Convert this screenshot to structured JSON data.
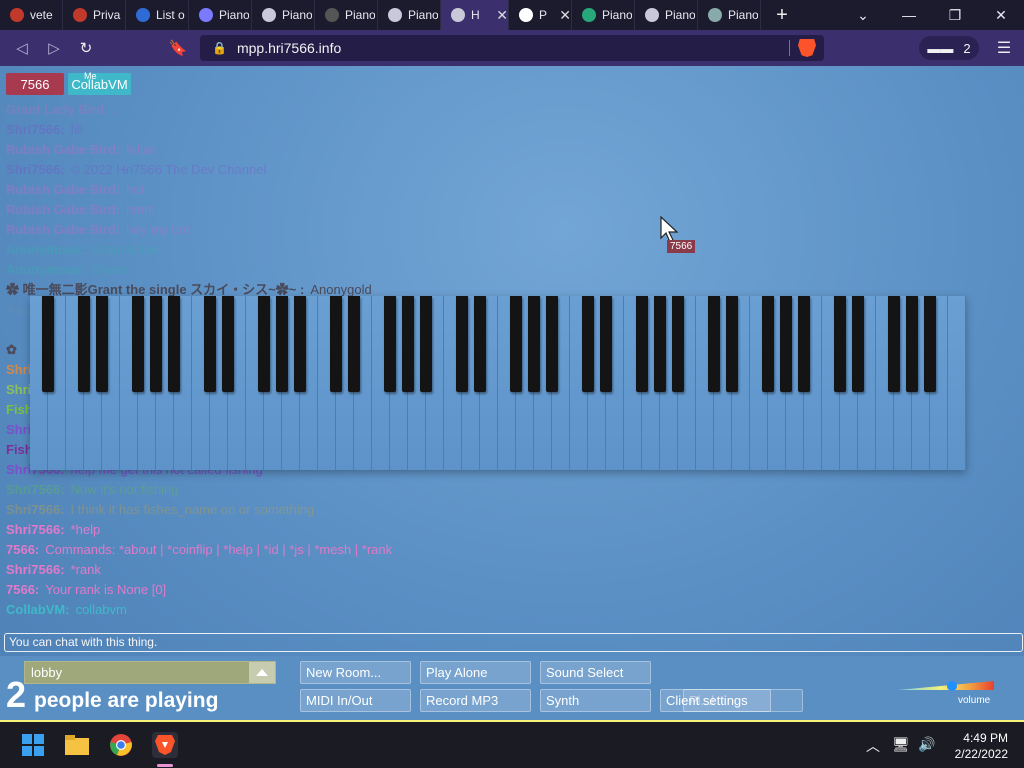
{
  "tabs": [
    {
      "label": "vete",
      "icon": "brave-shield-icon",
      "color": "#c0392b"
    },
    {
      "label": "Priva",
      "icon": "brave-shield-icon",
      "color": "#c0392b"
    },
    {
      "label": "List o",
      "icon": "bb-icon",
      "color": "#2f6bd6"
    },
    {
      "label": "Piano",
      "icon": "piano-swoosh-icon",
      "color": "#7a7aff"
    },
    {
      "label": "Piano",
      "icon": "globe-icon",
      "color": "#c8c8d8"
    },
    {
      "label": "Piano",
      "icon": "photo-icon",
      "color": "#555"
    },
    {
      "label": "Piano",
      "icon": "globe-icon",
      "color": "#c8c8d8"
    },
    {
      "label": "H",
      "icon": "globe-icon",
      "color": "#c8c8d8",
      "active": true
    },
    {
      "label": "P",
      "icon": "piano-keys-icon",
      "color": "#ffffff"
    },
    {
      "label": "Piano",
      "icon": "d-icon",
      "color": "#28a87a"
    },
    {
      "label": "Piano",
      "icon": "globe-icon",
      "color": "#c8c8d8"
    },
    {
      "label": "Piano",
      "icon": "bars-icon",
      "color": "#8aa"
    }
  ],
  "address": {
    "url": "mpp.hri7566.info",
    "private_windows": "2"
  },
  "users": [
    {
      "name": "7566",
      "color": "#a83a4f"
    },
    {
      "name": "CollabVM",
      "color": "#3fb9c9",
      "me_label": "Me"
    }
  ],
  "chat": [
    {
      "who": "Grant Lady Bird",
      "text": "...",
      "color": "#b86fc0",
      "faded": true
    },
    {
      "who": "Shri7566:",
      "text": "fill",
      "color": "#7a4fc9",
      "faded": true
    },
    {
      "who": "Rubish Gabe Bird:",
      "text": "fellas",
      "color": "#d066c9",
      "faded": true
    },
    {
      "who": "Shri7566:",
      "text": "© 2022 Hri7566 The Dev Channel",
      "color": "#7a4fc9",
      "faded": true
    },
    {
      "who": "Rubish Gabe Bird:",
      "text": "hot",
      "color": "#d066c9",
      "faded": true
    },
    {
      "who": "Rubish Gabe Bird:",
      "text": "hmm",
      "color": "#d066c9",
      "faded": true
    },
    {
      "who": "Rubish Gabe Bird:",
      "text": "hey my bot",
      "color": "#d066c9",
      "faded": true
    },
    {
      "who": "Anonymous:",
      "text": "Grant is fee",
      "color": "#2fb7a7",
      "faded": true
    },
    {
      "who": "Anonymous:",
      "text": "Share",
      "color": "#2fb7a7",
      "faded": true
    },
    {
      "who": "✿ 唯一無二影Grant the single スカイ・シス~✿~ :",
      "text": "Anonygold",
      "color": "#4a4a5a",
      "faded": false
    },
    {
      "who": "Anonymous:",
      "text": "",
      "color": "#6a8fb0",
      "faded": true
    },
    {
      "who": "",
      "text": "",
      "color": "#6a8fb0",
      "faded": true
    },
    {
      "who": "✿",
      "text": "",
      "color": "#4a4a5a",
      "faded": false
    },
    {
      "who": "Shri",
      "text": "",
      "color": "#d08a4a",
      "faded": false
    },
    {
      "who": "Shri",
      "text": "",
      "color": "#8ac05a",
      "faded": false
    },
    {
      "who": "Fish",
      "text": "",
      "color": "#7ac040",
      "faded": false
    },
    {
      "who": "Shri",
      "text": "",
      "color": "#7a4fc9",
      "faded": false
    },
    {
      "who": "Fish",
      "text": "",
      "color": "#7a2f9a",
      "faded": false
    },
    {
      "who": "Shri7566:",
      "text": "help me get this not called fishing",
      "color": "#7a4fc9",
      "faded": false
    },
    {
      "who": "Shri7566:",
      "text": "Now it's not fishing",
      "color": "#5fbf4a",
      "faded": true
    },
    {
      "who": "Shri7566:",
      "text": "I think it has fishes_name on or something",
      "color": "#c9a43a",
      "faded": true
    },
    {
      "who": "Shri7566:",
      "text": "*help",
      "color": "#e07ac9",
      "faded": false
    },
    {
      "who": "7566:",
      "text": "Commands: *about | *coinflip | *help | *id | *js | *mesh | *rank",
      "color": "#e07ac9",
      "faded": false
    },
    {
      "who": "Shri7566:",
      "text": "*rank",
      "color": "#e07ac9",
      "faded": false
    },
    {
      "who": "7566:",
      "text": "Your rank is None [0]",
      "color": "#e07ac9",
      "faded": false
    },
    {
      "who": "CollabVM:",
      "text": "collabvm",
      "color": "#3fb9c9",
      "faded": false
    }
  ],
  "cursor_label": "7566",
  "chat_input_placeholder": "You can chat with this thing.",
  "room": {
    "name": "lobby"
  },
  "players": {
    "count": "2",
    "text": "people are playing"
  },
  "buttons": {
    "new_room": "New Room...",
    "play_alone": "Play Alone",
    "sound_select": "Sound Select",
    "midi": "MIDI In/Out",
    "record": "Record MP3",
    "synth": "Synth",
    "client_settings": "Client settings",
    "client_settings_ghost": "Pl...l"
  },
  "volume_label": "volume",
  "clock": {
    "time": "4:49 PM",
    "date": "2/22/2022"
  }
}
